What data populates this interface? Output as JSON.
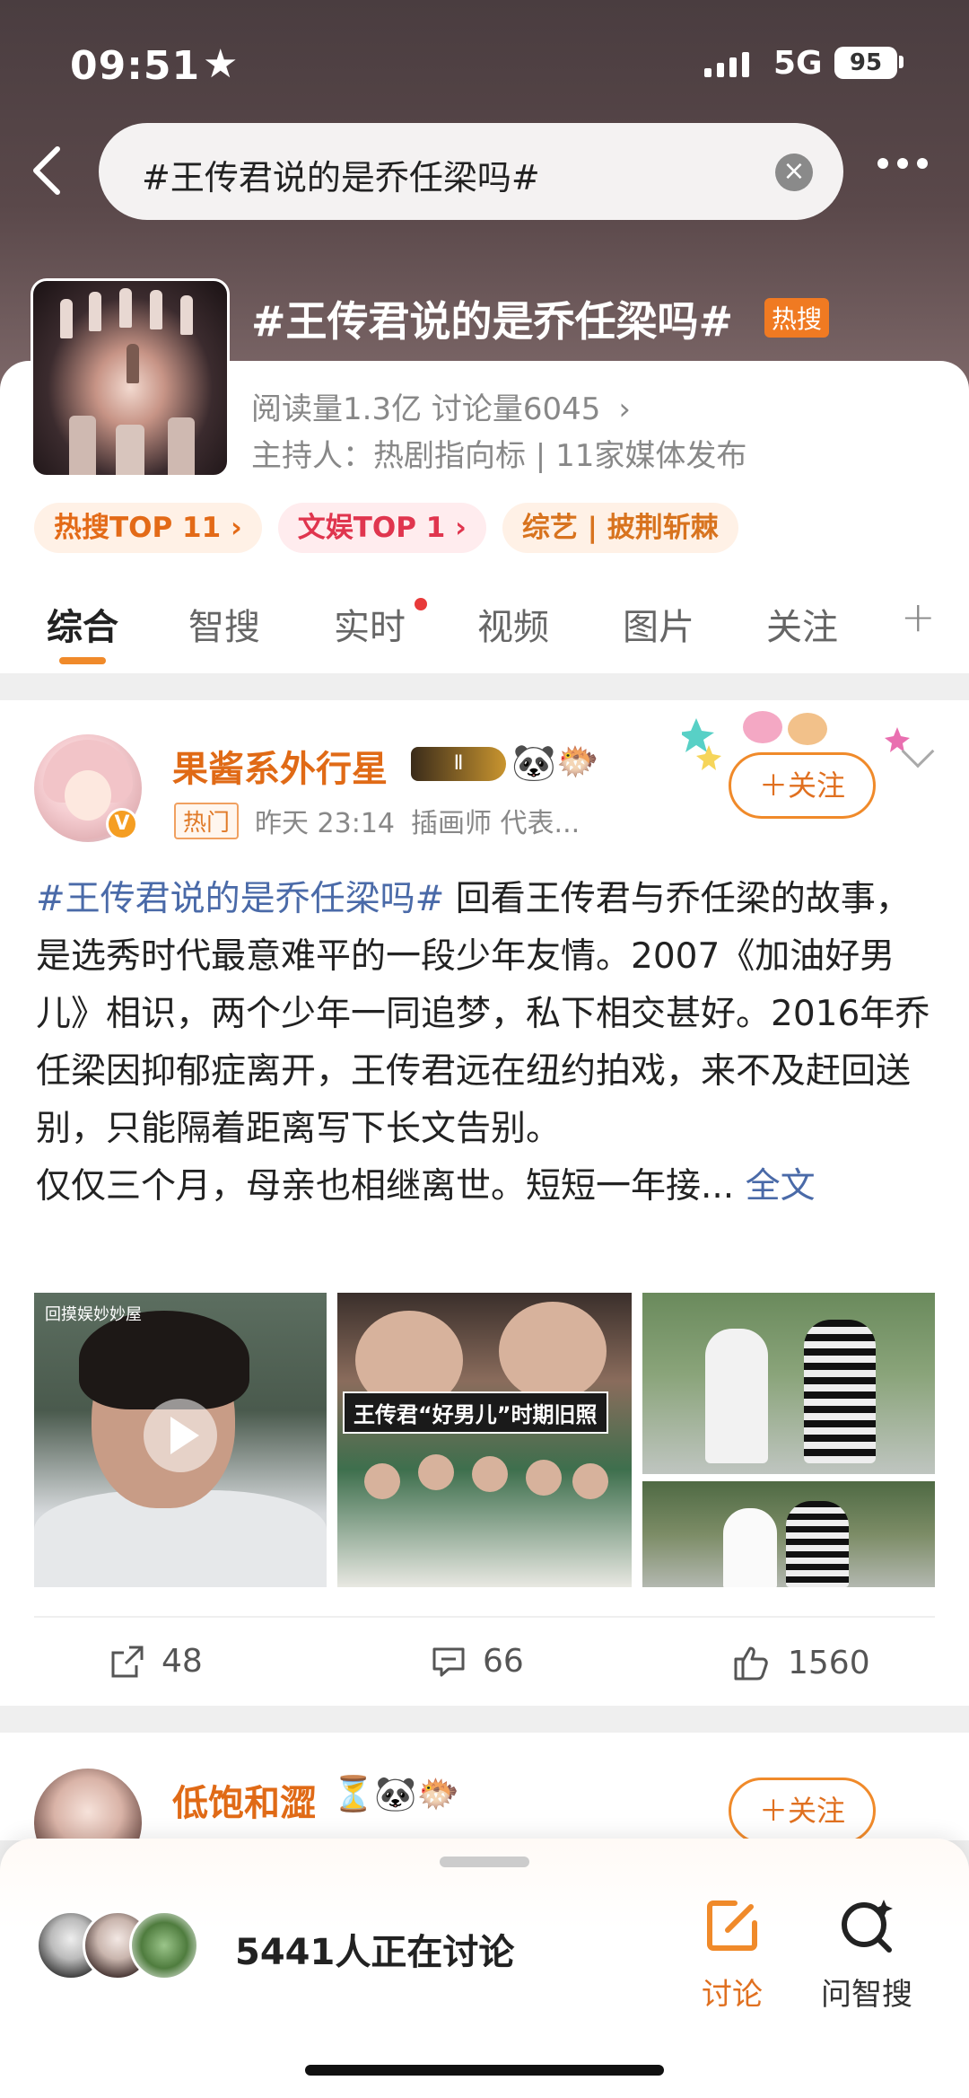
{
  "status_bar": {
    "time": "09:51",
    "network": "5G",
    "battery": "95"
  },
  "search": {
    "query": "#王传君说的是乔任梁吗#"
  },
  "topic": {
    "title": "#王传君说的是乔任梁吗#",
    "hot_label": "热搜",
    "stats": "阅读量1.3亿  讨论量6045",
    "host": "主持人：热剧指向标 | 11家媒体发布",
    "chips": [
      "热搜TOP 11 ›",
      "文娱TOP 1 ›",
      "综艺 | 披荆斩棘"
    ]
  },
  "tabs": [
    "综合",
    "智搜",
    "实时",
    "视频",
    "图片",
    "关注"
  ],
  "post": {
    "username": "果酱系外行星",
    "level_badge": "Ⅱ",
    "hot_badge": "热门",
    "time": "昨天 23:14",
    "desc": "插画师 代表...",
    "follow_label": "＋关注",
    "hashtag": "#王传君说的是乔任梁吗#",
    "text": " 回看王传君与乔任梁的故事，是选秀时代最意难平的一段少年友情。2007《加油好男儿》相识，两个少年一同追梦，私下相交甚好。2016年乔任梁因抑郁症离开，王传君远在纽约拍戏，来不及赶回送别，只能隔着距离写下长文告别。",
    "text2": "仅仅三个月，母亲也相继离世。短短一年接... ",
    "full_label": "全文",
    "image2_caption": "王传君“好男儿”时期旧照",
    "shares": "48",
    "comments": "66",
    "likes": "1560"
  },
  "post2": {
    "username": "低饱和澀",
    "follow_label": "＋关注"
  },
  "sheet": {
    "discuss_count": "5441人正在讨论",
    "btn_discuss": "讨论",
    "btn_ai": "问智搜"
  },
  "colors": {
    "accent": "#f08a2a",
    "link": "#4a6aa8",
    "username": "#e06a16"
  }
}
